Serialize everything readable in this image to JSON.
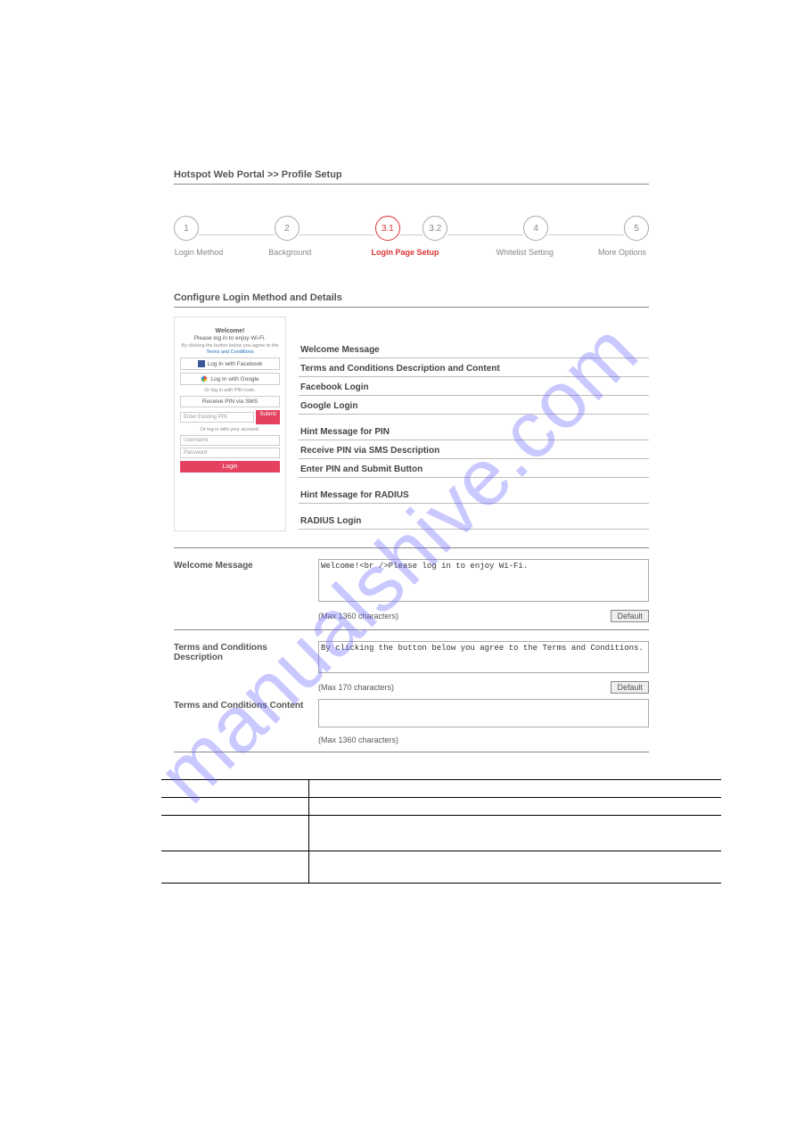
{
  "watermark": "manualshive.com",
  "breadcrumb": "Hotspot Web Portal >> Profile Setup",
  "stepper": {
    "steps": [
      {
        "num": "1",
        "label": "Login Method",
        "active": false
      },
      {
        "num": "2",
        "label": "Background",
        "active": false
      },
      {
        "num": "3.1",
        "label": "Login Page Setup",
        "active": true
      },
      {
        "num": "3.2",
        "label": "",
        "active": false
      },
      {
        "num": "4",
        "label": "Whitelist Setting",
        "active": false
      },
      {
        "num": "5",
        "label": "More Options",
        "active": false
      }
    ]
  },
  "section_title": "Configure Login Method and Details",
  "preview": {
    "welcome": "Welcome!",
    "sub": "Please log in to enjoy Wi-Fi.",
    "tc_prefix": "By clicking the button below you agree to the",
    "tc_link": "Terms and Conditions",
    "fb_label": "Log In with Facebook",
    "gg_label": "Log In with Google",
    "or_pin": "Or log in with PIN code.",
    "receive_pin": "Receive PIN via SMS",
    "pin_placeholder": "Enter Existing PIN",
    "submit_label": "Submit",
    "or_account": "Or log in with your account.",
    "username_ph": "Username",
    "password_ph": "Password",
    "login_label": "Login"
  },
  "options": [
    "Welcome Message",
    "Terms and Conditions Description and Content",
    "Facebook Login",
    "Google Login",
    "",
    "Hint Message for PIN",
    "Receive PIN via SMS Description",
    "Enter PIN and Submit Button",
    "",
    "Hint Message for RADIUS",
    "",
    "RADIUS Login"
  ],
  "fields": {
    "welcome": {
      "label": "Welcome Message",
      "value": "Welcome!<br />Please log in to enjoy Wi-Fi.",
      "hint": "(Max 1360 characters)",
      "default_btn": "Default"
    },
    "tc_desc": {
      "label": "Terms and Conditions Description",
      "value": "By clicking the button below you agree to the Terms and Conditions.",
      "hint": "(Max 170 characters)",
      "default_btn": "Default"
    },
    "tc_content": {
      "label": "Terms and Conditions Content",
      "value": "",
      "hint": "(Max 1360 characters)"
    }
  },
  "desc_table": [
    {
      "item": "",
      "desc": ""
    },
    {
      "item": "",
      "desc": ""
    },
    {
      "item": "",
      "desc": ""
    },
    {
      "item": "",
      "desc": ""
    }
  ]
}
